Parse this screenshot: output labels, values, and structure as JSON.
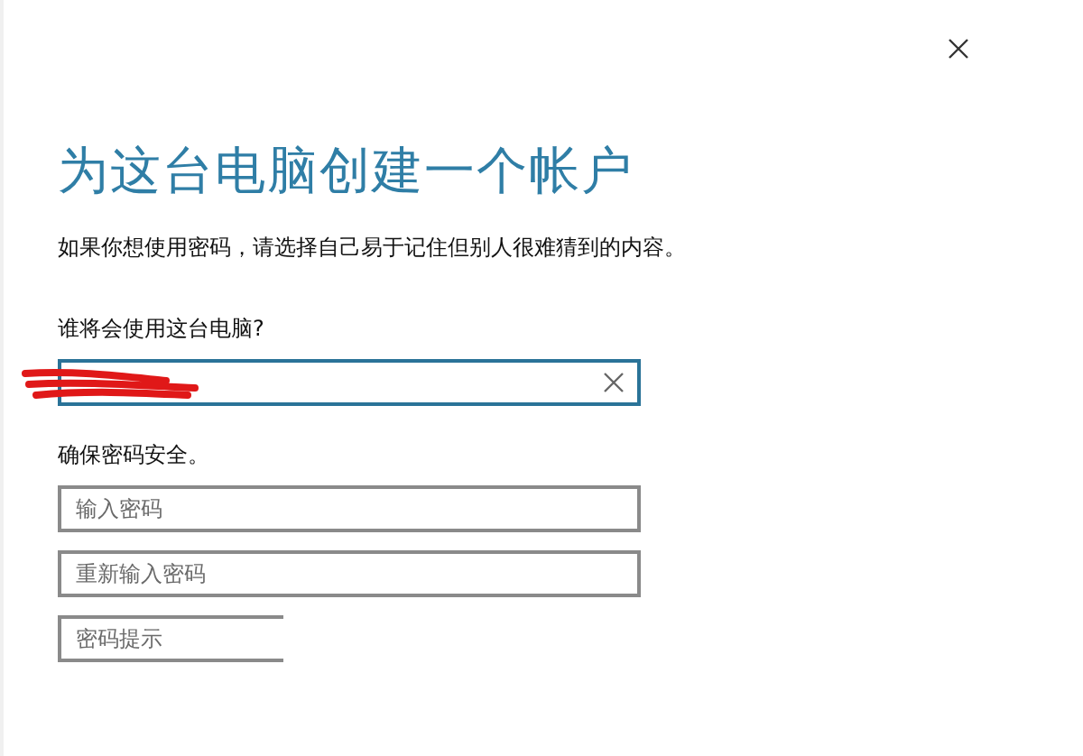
{
  "dialog": {
    "title": "为这台电脑创建一个帐户",
    "intro": "如果你想使用密码，请选择自己易于记住但别人很难猜到的内容。",
    "user_section": {
      "label": "谁将会使用这台电脑?",
      "field": {
        "focused": true,
        "redacted": true
      }
    },
    "password_section": {
      "label": "确保密码安全。",
      "fields": [
        {
          "placeholder": "输入密码",
          "cut_off": false
        },
        {
          "placeholder": "重新输入密码",
          "cut_off": false
        },
        {
          "placeholder": "密码提示",
          "cut_off": true
        }
      ]
    }
  }
}
